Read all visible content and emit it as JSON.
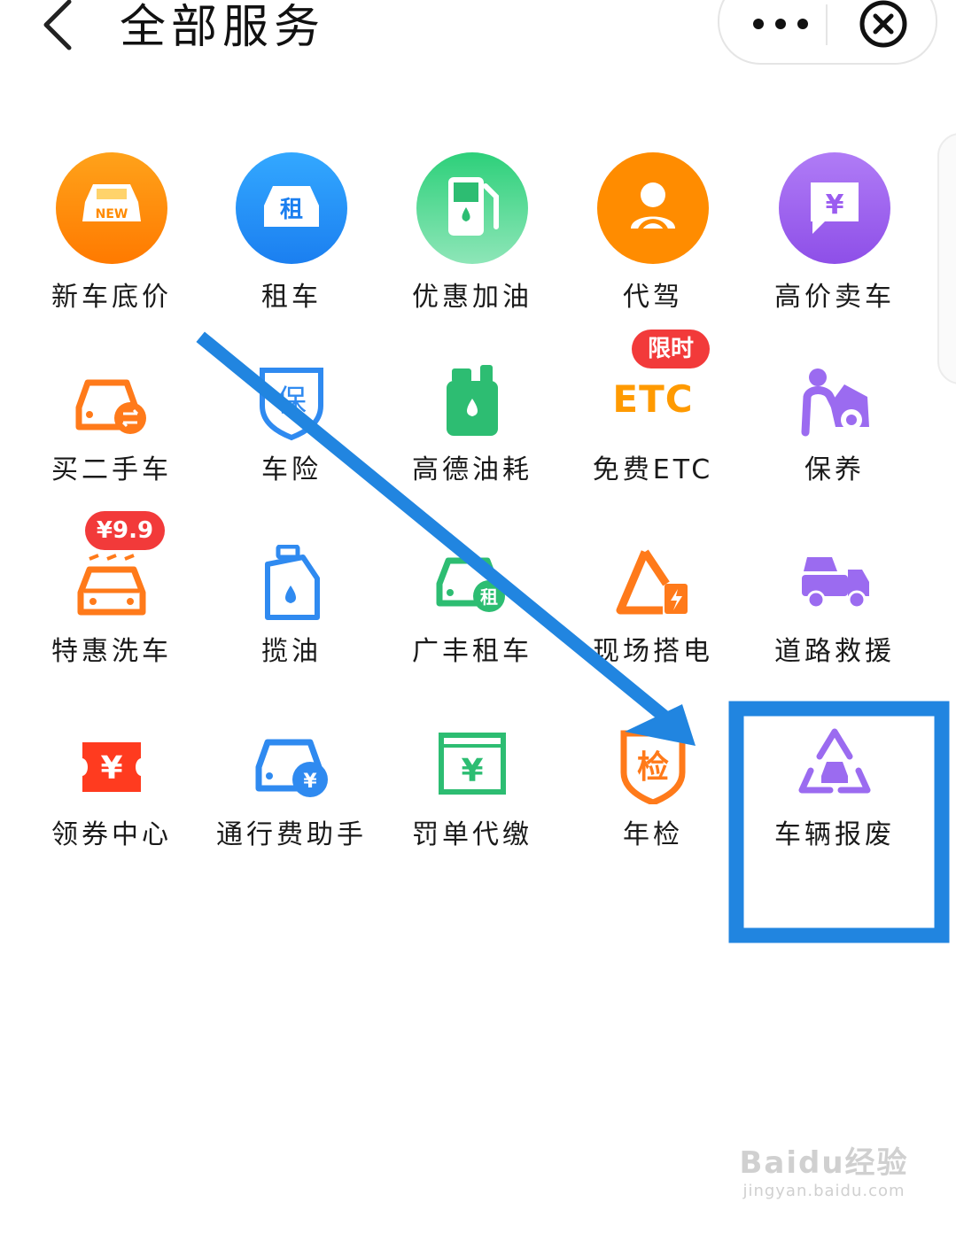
{
  "header": {
    "title": "全部服务",
    "back_icon": "chevron-left-icon",
    "more_icon": "more-dots-icon",
    "close_icon": "close-circle-icon"
  },
  "services": [
    {
      "label": "新车底价",
      "icon": "new-car-icon"
    },
    {
      "label": "租车",
      "icon": "rent-car-icon",
      "icon_text": "租"
    },
    {
      "label": "优惠加油",
      "icon": "fuel-pump-icon"
    },
    {
      "label": "代驾",
      "icon": "driver-icon"
    },
    {
      "label": "高价卖车",
      "icon": "sell-car-icon",
      "icon_text": "¥"
    },
    {
      "label": "买二手车",
      "icon": "used-car-icon"
    },
    {
      "label": "车险",
      "icon": "insurance-shield-icon",
      "icon_text": "保"
    },
    {
      "label": "高德油耗",
      "icon": "fuel-can-icon"
    },
    {
      "label": "免费ETC",
      "icon": "etc-icon",
      "icon_text": "ETC",
      "badge": "限时"
    },
    {
      "label": "保养",
      "icon": "maintenance-icon"
    },
    {
      "label": "特惠洗车",
      "icon": "car-wash-icon",
      "badge": "¥9.9"
    },
    {
      "label": "揽油",
      "icon": "oil-bottle-icon"
    },
    {
      "label": "广丰租车",
      "icon": "gf-rent-icon",
      "icon_text": "租"
    },
    {
      "label": "现场搭电",
      "icon": "jump-start-icon"
    },
    {
      "label": "道路救援",
      "icon": "tow-truck-icon"
    },
    {
      "label": "领券中心",
      "icon": "coupon-icon",
      "icon_text": "¥"
    },
    {
      "label": "通行费助手",
      "icon": "toll-icon",
      "icon_text": "¥"
    },
    {
      "label": "罚单代缴",
      "icon": "fine-icon",
      "icon_text": "¥"
    },
    {
      "label": "年检",
      "icon": "inspection-icon",
      "icon_text": "检"
    },
    {
      "label": "车辆报废",
      "icon": "recycle-car-icon"
    }
  ],
  "watermark": {
    "brand": "Baidu经验",
    "url": "jingyan.baidu.com"
  },
  "colors": {
    "annotation_blue": "#2185e0",
    "orange": "#ff9a00",
    "purple": "#9b6bf0",
    "green": "#2dbd72"
  }
}
